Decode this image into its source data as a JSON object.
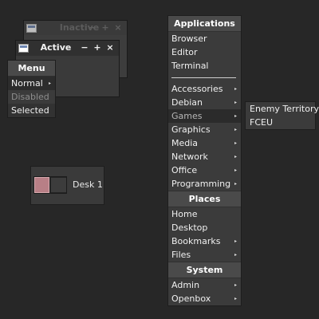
{
  "windows": {
    "inactive": {
      "title": "Inactive",
      "buttons": {
        "minimize": "−",
        "maximize": "+",
        "close": "×"
      }
    },
    "active": {
      "title": "Active",
      "buttons": {
        "minimize": "−",
        "maximize": "+",
        "close": "×"
      }
    }
  },
  "demo_menu": {
    "title": "Menu",
    "items": [
      "Normal",
      "Disabled",
      "Selected"
    ],
    "normal_arrow": "▸"
  },
  "root_menu": {
    "applications_title": "Applications",
    "apps_top": [
      "Browser",
      "Editor",
      "Terminal"
    ],
    "apps_categories": [
      "Accessories",
      "Debian",
      "Games",
      "Graphics",
      "Media",
      "Network",
      "Office",
      "Programming"
    ],
    "places_title": "Places",
    "places": [
      "Home",
      "Desktop",
      "Bookmarks",
      "Files"
    ],
    "system_title": "System",
    "system": [
      "Admin",
      "Openbox"
    ],
    "arrow": "▸"
  },
  "games_menu": {
    "items": [
      "Enemy Territory",
      "FCEU"
    ]
  },
  "pager": {
    "desk_label": "Desk 1"
  },
  "colors": {
    "background": "#272727",
    "menu_bg": "#3b3b3b",
    "menu_title_bg": "#4a4a4a",
    "highlight": "#2b2b2b",
    "desk_active": "#b87f86"
  }
}
